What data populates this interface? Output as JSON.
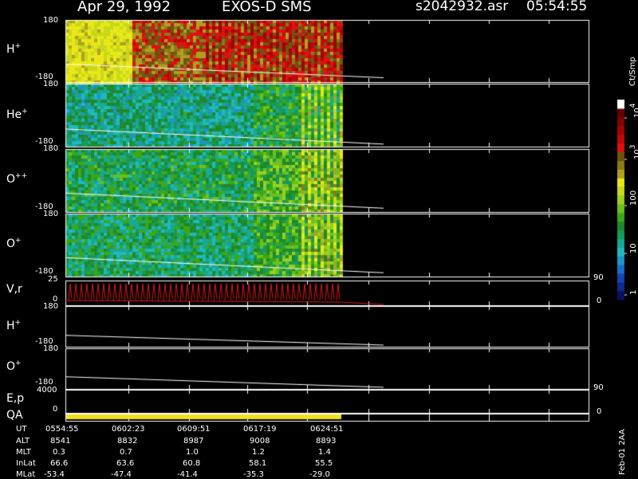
{
  "header": {
    "date": "Apr 29, 1992",
    "instrument": "EXOS-D SMS",
    "file": "s2042932.asr",
    "time": "05:54:55"
  },
  "colorbar": {
    "unit": "Ct/Smp",
    "ticks": [
      "1",
      "10",
      "100",
      "10",
      "10"
    ],
    "tick_exponents": [
      "",
      "",
      "",
      "3",
      "4"
    ],
    "colors": [
      "#0a1060",
      "#0f2a90",
      "#1346b4",
      "#1a6dc8",
      "#1e93c8",
      "#20b8c0",
      "#1aa890",
      "#169a5a",
      "#1e8a2a",
      "#3aa818",
      "#6cc01c",
      "#98d020",
      "#c8d81c",
      "#e8e818",
      "#b0a020",
      "#8a7a18",
      "#6e5410",
      "#e01010",
      "#c00808",
      "#a00404",
      "#800202",
      "#640000",
      "#ffffff"
    ]
  },
  "chart_data": {
    "type": "heatmap",
    "title": "Apr 29, 1992   EXOS-D SMS",
    "panels": [
      {
        "name": "H",
        "sup": "+",
        "ymax": "180",
        "ymin": "-180",
        "kind": "spec",
        "level": 0.78
      },
      {
        "name": "He",
        "sup": "+",
        "ymax": "180",
        "ymin": "-180",
        "kind": "spec",
        "level": 0.32
      },
      {
        "name": "O",
        "sup": "++",
        "ymax": "180",
        "ymin": "-180",
        "kind": "spec",
        "level": 0.38
      },
      {
        "name": "O",
        "sup": "+",
        "ymax": "180",
        "ymin": "-180",
        "kind": "spec",
        "level": 0.36
      },
      {
        "name": "V,r",
        "sup": "",
        "ymax": "25",
        "ymin": "0",
        "right_top": "90",
        "right_bottom": "0",
        "kind": "vr"
      },
      {
        "name": "H",
        "sup": "+",
        "ymax": "180",
        "ymin": "-180",
        "kind": "line"
      },
      {
        "name": "O",
        "sup": "+",
        "ymax": "180",
        "ymin": "-180",
        "kind": "line"
      },
      {
        "name": "E,p",
        "sup": "",
        "ymax": "4000",
        "ymin": "",
        "right_top": "90",
        "right_bottom": "",
        "kind": "line"
      },
      {
        "name": "QA",
        "sup": "",
        "ymax": "",
        "ymin": "0",
        "right_top": "",
        "right_bottom": "0",
        "kind": "qa"
      }
    ],
    "x_ticks": [
      "0554:55",
      "0602:23",
      "0609:51",
      "0617:19",
      "0624:51"
    ],
    "ephemeris": [
      {
        "label": "UT",
        "values": [
          "0554:55",
          "0602:23",
          "0609:51",
          "0617:19",
          "0624:51"
        ]
      },
      {
        "label": "ALT",
        "values": [
          "8541",
          "8832",
          "8987",
          "9008",
          "8893"
        ]
      },
      {
        "label": "MLT",
        "values": [
          "0.3",
          "0.7",
          "1.0",
          "1.2",
          "1.4"
        ]
      },
      {
        "label": "InLat",
        "values": [
          "66.6",
          "63.6",
          "60.8",
          "58.1",
          "55.5"
        ]
      },
      {
        "label": "MLat",
        "values": [
          "-53.4",
          "-47.4",
          "-41.4",
          "-35.3",
          "-29.0"
        ]
      }
    ]
  },
  "footer_stamp": "Feb-01 2AA"
}
